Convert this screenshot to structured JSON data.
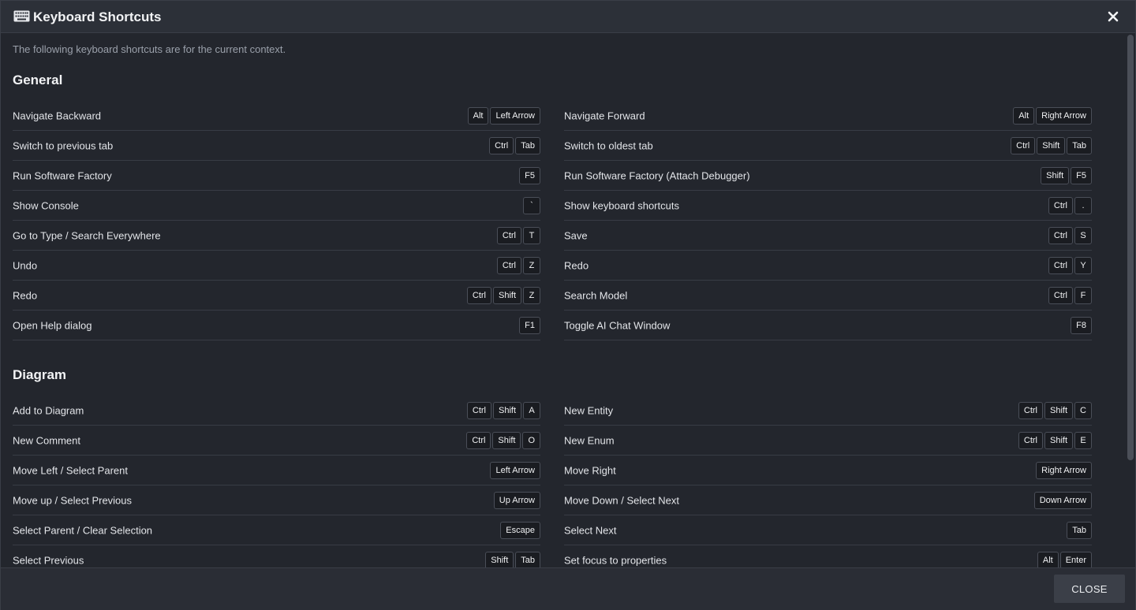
{
  "dialog": {
    "title": "Keyboard Shortcuts",
    "title_icon": "keyboard-icon",
    "close_icon": "close-icon",
    "intro": "The following keyboard shortcuts are for the current context.",
    "close_button": "CLOSE"
  },
  "sections": [
    {
      "title": "General",
      "left": [
        {
          "label": "Navigate Backward",
          "keys": [
            "Alt",
            "Left Arrow"
          ]
        },
        {
          "label": "Switch to previous tab",
          "keys": [
            "Ctrl",
            "Tab"
          ]
        },
        {
          "label": "Run Software Factory",
          "keys": [
            "F5"
          ]
        },
        {
          "label": "Show Console",
          "keys": [
            "`"
          ]
        },
        {
          "label": "Go to Type / Search Everywhere",
          "keys": [
            "Ctrl",
            "T"
          ]
        },
        {
          "label": "Undo",
          "keys": [
            "Ctrl",
            "Z"
          ]
        },
        {
          "label": "Redo",
          "keys": [
            "Ctrl",
            "Shift",
            "Z"
          ]
        },
        {
          "label": "Open Help dialog",
          "keys": [
            "F1"
          ]
        }
      ],
      "right": [
        {
          "label": "Navigate Forward",
          "keys": [
            "Alt",
            "Right Arrow"
          ]
        },
        {
          "label": "Switch to oldest tab",
          "keys": [
            "Ctrl",
            "Shift",
            "Tab"
          ]
        },
        {
          "label": "Run Software Factory (Attach Debugger)",
          "keys": [
            "Shift",
            "F5"
          ]
        },
        {
          "label": "Show keyboard shortcuts",
          "keys": [
            "Ctrl",
            "."
          ]
        },
        {
          "label": "Save",
          "keys": [
            "Ctrl",
            "S"
          ]
        },
        {
          "label": "Redo",
          "keys": [
            "Ctrl",
            "Y"
          ]
        },
        {
          "label": "Search Model",
          "keys": [
            "Ctrl",
            "F"
          ]
        },
        {
          "label": "Toggle AI Chat Window",
          "keys": [
            "F8"
          ]
        }
      ]
    },
    {
      "title": "Diagram",
      "left": [
        {
          "label": "Add to Diagram",
          "keys": [
            "Ctrl",
            "Shift",
            "A"
          ]
        },
        {
          "label": "New Comment",
          "keys": [
            "Ctrl",
            "Shift",
            "O"
          ]
        },
        {
          "label": "Move Left / Select Parent",
          "keys": [
            "Left Arrow"
          ]
        },
        {
          "label": "Move up / Select Previous",
          "keys": [
            "Up Arrow"
          ]
        },
        {
          "label": "Select Parent / Clear Selection",
          "keys": [
            "Escape"
          ]
        },
        {
          "label": "Select Previous",
          "keys": [
            "Shift",
            "Tab"
          ]
        }
      ],
      "right": [
        {
          "label": "New Entity",
          "keys": [
            "Ctrl",
            "Shift",
            "C"
          ]
        },
        {
          "label": "New Enum",
          "keys": [
            "Ctrl",
            "Shift",
            "E"
          ]
        },
        {
          "label": "Move Right",
          "keys": [
            "Right Arrow"
          ]
        },
        {
          "label": "Move Down / Select Next",
          "keys": [
            "Down Arrow"
          ]
        },
        {
          "label": "Select Next",
          "keys": [
            "Tab"
          ]
        },
        {
          "label": "Set focus to properties",
          "keys": [
            "Alt",
            "Enter"
          ]
        }
      ]
    }
  ]
}
